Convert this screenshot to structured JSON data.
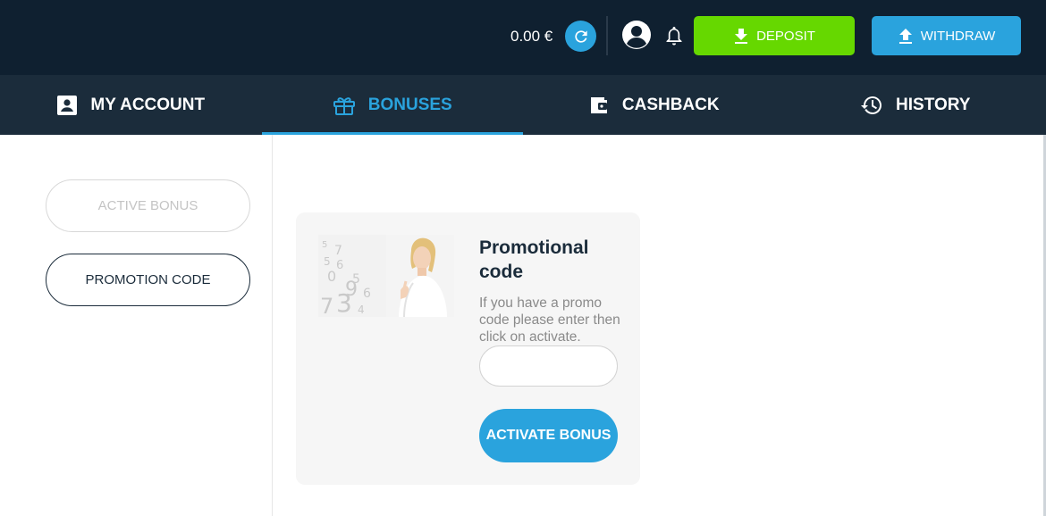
{
  "header": {
    "balance": "0.00 €",
    "deposit_label": "DEPOSIT",
    "withdraw_label": "WITHDRAW",
    "icons": {
      "refresh": "refresh-icon",
      "profile": "profile-icon",
      "bell": "bell-icon",
      "deposit": "download-icon",
      "withdraw": "upload-icon"
    }
  },
  "tabs": [
    {
      "label": "MY ACCOUNT",
      "icon": "account-card-icon",
      "active": false
    },
    {
      "label": "BONUSES",
      "icon": "gift-icon",
      "active": true
    },
    {
      "label": "CASHBACK",
      "icon": "wallet-icon",
      "active": false
    },
    {
      "label": "HISTORY",
      "icon": "history-icon",
      "active": false
    }
  ],
  "sidebar": {
    "active_bonus_label": "ACTIVE BONUS",
    "promotion_code_label": "PROMOTION CODE"
  },
  "promo_card": {
    "title": "Promotional code",
    "description": "If you have a promo code please enter then click on activate.",
    "input_value": "",
    "button_label": "ACTIVATE BONUS"
  },
  "colors": {
    "header_bg": "#0f2030",
    "tabs_bg": "#1b2c3b",
    "accent_blue": "#2aa3dd",
    "deposit_green": "#66d800"
  }
}
